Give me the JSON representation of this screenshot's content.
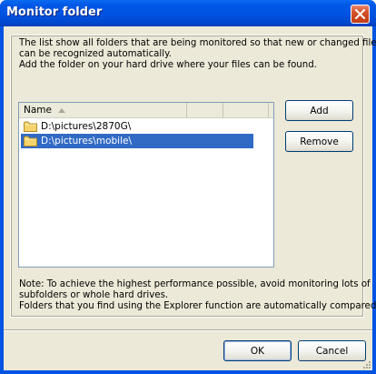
{
  "window": {
    "title": "Monitor folder"
  },
  "description": {
    "lines": [
      "The list show all folders that are being monitored so that new or changed files",
      "can be recognized automatically.",
      "Add the folder on your hard drive where your files can be found."
    ]
  },
  "list": {
    "columns": [
      "Name",
      "",
      ""
    ],
    "items": [
      {
        "path": "D:\\pictures\\2870G\\",
        "selected": false
      },
      {
        "path": "D:\\pictures\\mobile\\",
        "selected": true
      }
    ]
  },
  "side_buttons": {
    "add": "Add",
    "remove": "Remove"
  },
  "note": {
    "lines": [
      "Note: To achieve the highest performance possible, avoid monitoring lots of",
      "subfolders or whole hard drives.",
      "Folders that you find using the Explorer function are automatically compared."
    ]
  },
  "footer": {
    "ok": "OK",
    "cancel": "Cancel"
  },
  "colors": {
    "selection": "#316ac5",
    "titlebar": "#0054e3",
    "dialog_bg": "#ece9d8"
  }
}
